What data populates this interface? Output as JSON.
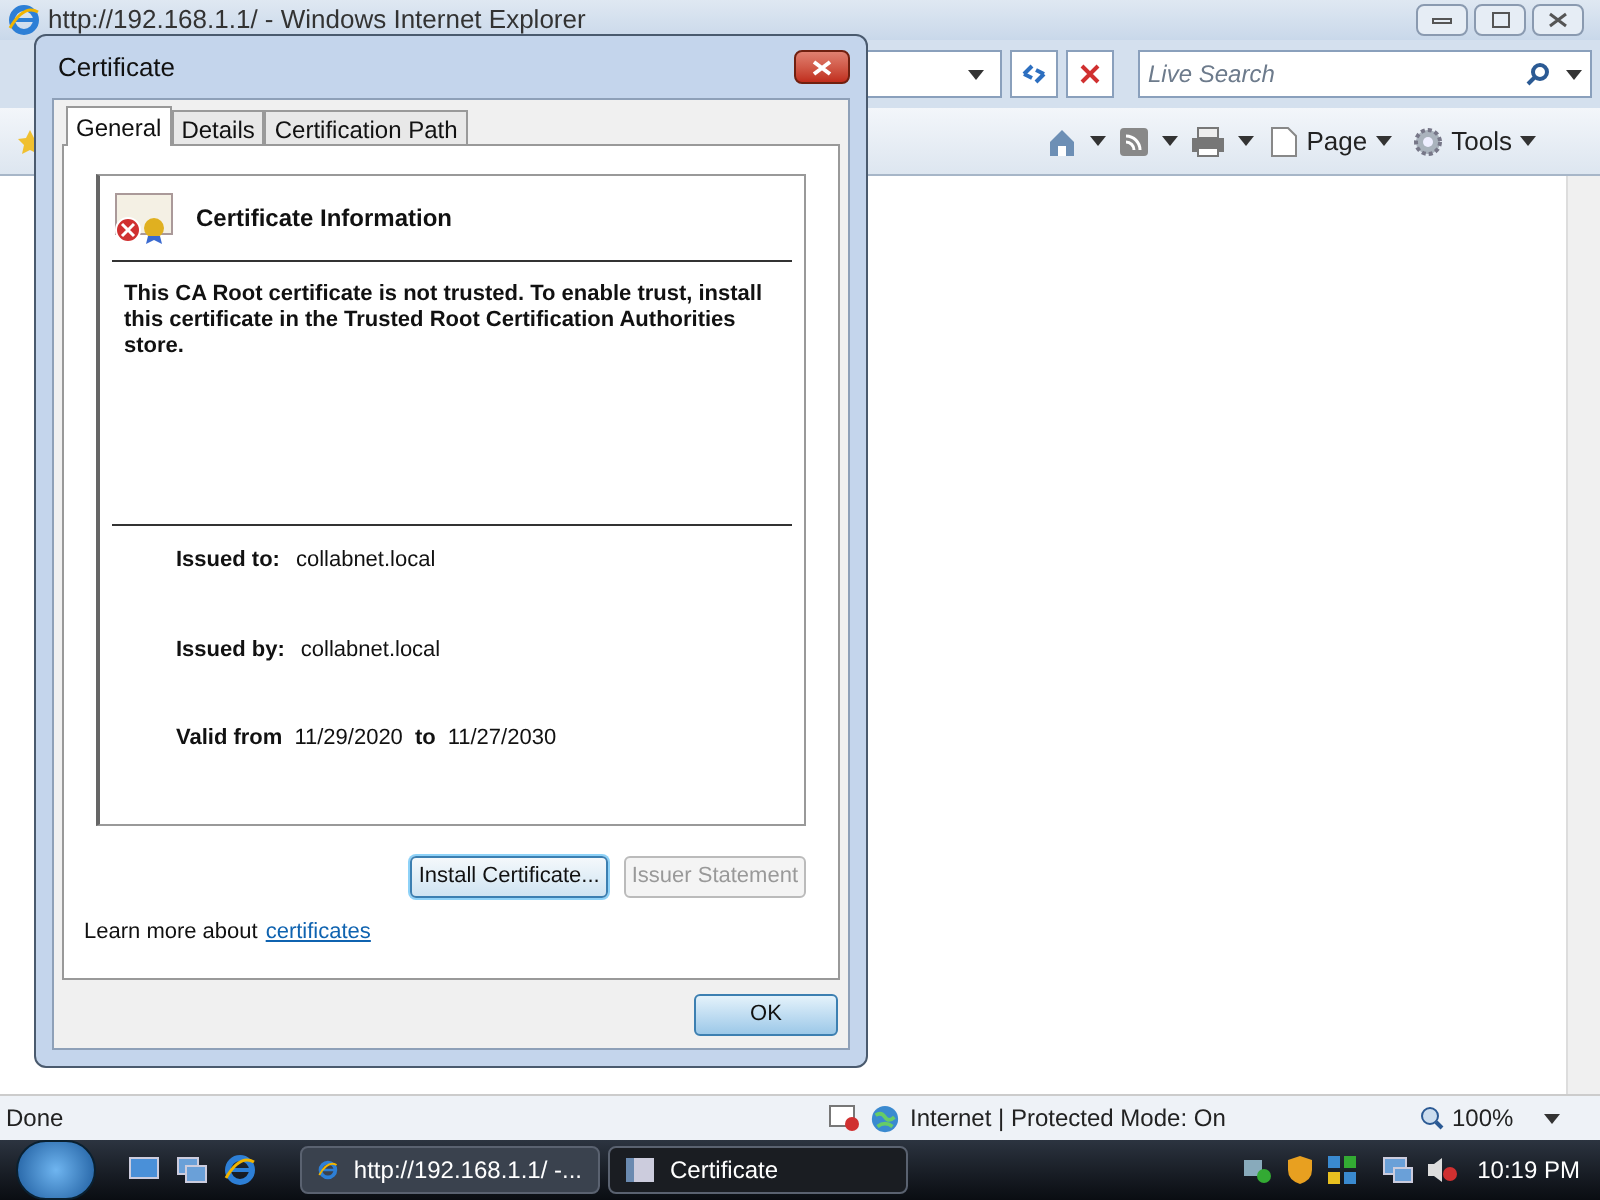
{
  "browser": {
    "title": "http://192.168.1.1/ - Windows Internet Explorer",
    "search_placeholder": "Live Search",
    "toolbar": [
      "Page",
      "Tools"
    ],
    "status_bar": {
      "text": "Done",
      "zone": "Internet | Protected Mode: On",
      "zoom": "100%"
    }
  },
  "dialog": {
    "title": "Certificate",
    "tabs": [
      {
        "label": "General",
        "selected": true
      },
      {
        "label": "Details",
        "selected": false
      },
      {
        "label": "Certification Path",
        "selected": false
      }
    ],
    "heading": "Certificate Information",
    "message": "This CA Root certificate is not trusted. To enable trust, install this certificate in the Trusted Root Certification Authorities store.",
    "fields": [
      {
        "label": "Issued to:",
        "value": "collabnet.local"
      },
      {
        "label": "Issued by:",
        "value": "collabnet.local"
      }
    ],
    "validity": {
      "label": "Valid from",
      "from": "11/29/2020",
      "to_label": "to",
      "to": "11/27/2030"
    },
    "buttons": [
      {
        "label": "Install Certificate...",
        "disabled": false,
        "focused": true
      },
      {
        "label": "Issuer Statement",
        "disabled": true,
        "focused": false
      }
    ],
    "learn_more": {
      "text": "Learn more about",
      "link": "certificates"
    },
    "ok": "OK"
  },
  "taskbar": {
    "tasks": [
      {
        "label": "http://192.168.1.1/ -...",
        "selected": false
      },
      {
        "label": "Certificate",
        "selected": true
      }
    ],
    "clock": "10:19 PM"
  }
}
